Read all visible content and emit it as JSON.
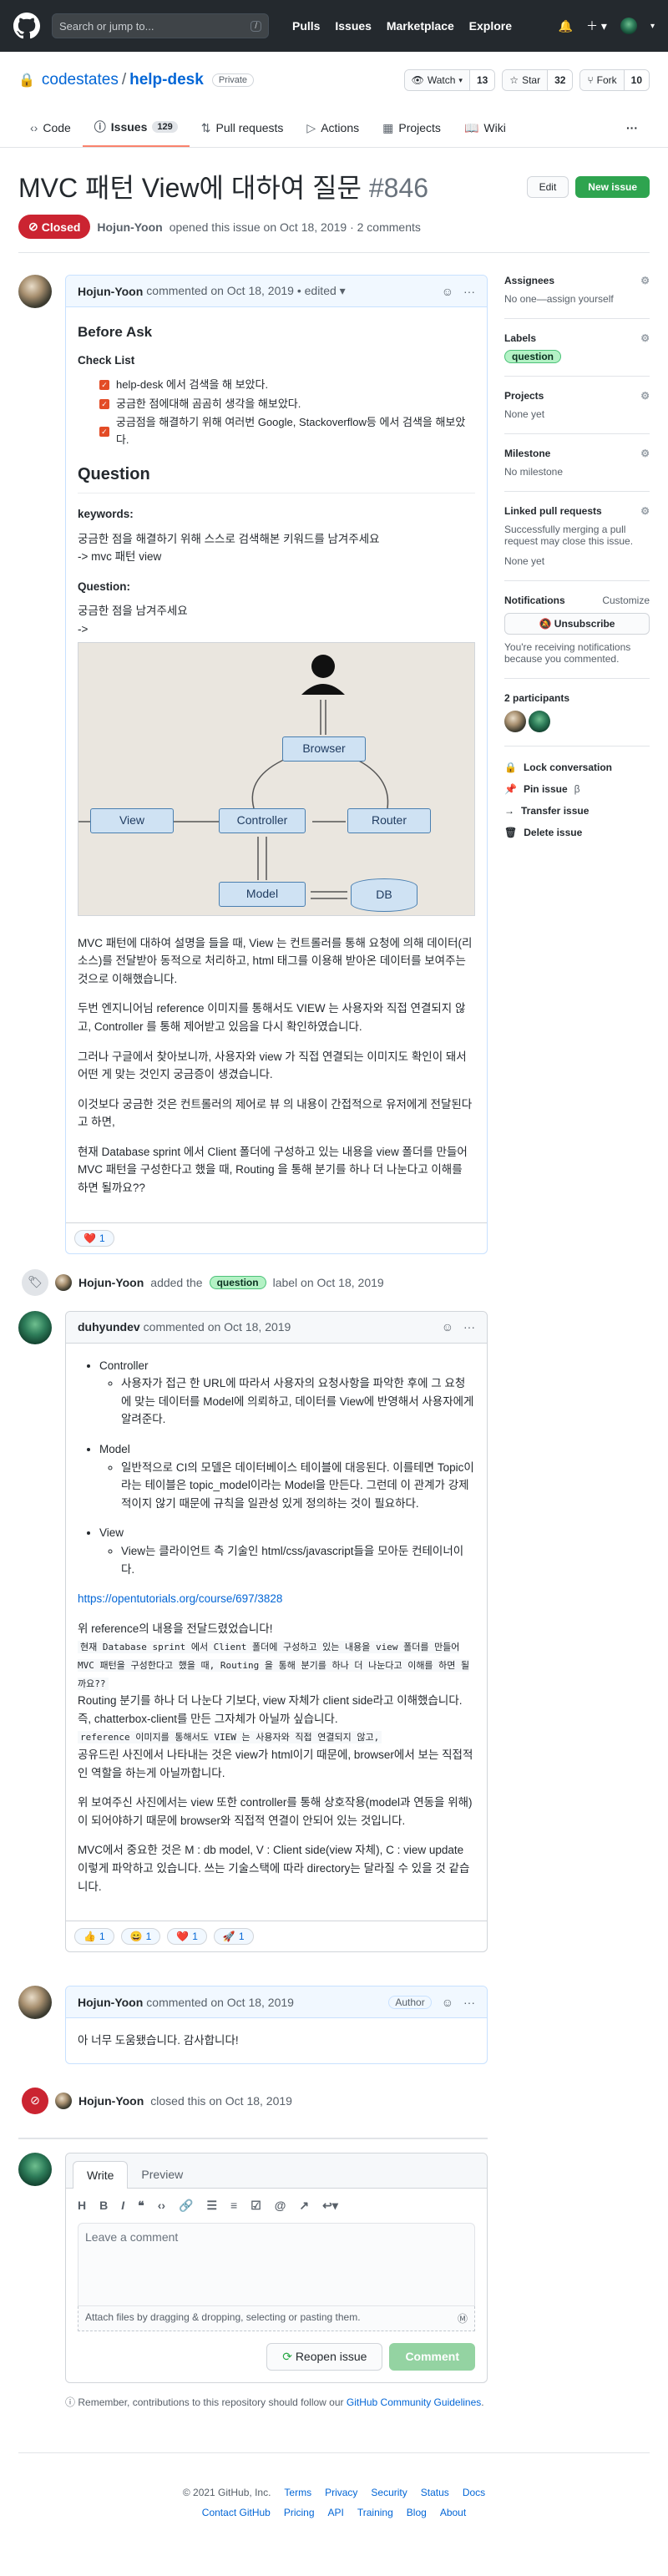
{
  "header": {
    "search_placeholder": "Search or jump to...",
    "search_key": "/",
    "nav": [
      "Pulls",
      "Issues",
      "Marketplace",
      "Explore"
    ]
  },
  "repo": {
    "owner": "codestates",
    "sep": "/",
    "name": "help-desk",
    "visibility": "Private",
    "watch_label": "Watch",
    "watch_count": "13",
    "star_label": "Star",
    "star_count": "32",
    "fork_label": "Fork",
    "fork_count": "10",
    "tabs": [
      {
        "label": "Code"
      },
      {
        "label": "Issues",
        "count": "129"
      },
      {
        "label": "Pull requests"
      },
      {
        "label": "Actions"
      },
      {
        "label": "Projects"
      },
      {
        "label": "Wiki"
      }
    ]
  },
  "issue": {
    "title": "MVC 패턴 View에 대하여 질문",
    "number": "#846",
    "edit_label": "Edit",
    "new_label": "New issue",
    "state": "Closed",
    "author": "Hojun-Yoon",
    "opened_text": "opened this issue on Oct 18, 2019 · 2 comments"
  },
  "comments": [
    {
      "author": "Hojun-Yoon",
      "meta": "commented on Oct 18, 2019 • edited ▾",
      "before_ask": "Before Ask",
      "checklist_title": "Check List",
      "checklist": [
        "help-desk 에서 검색을 해 보았다.",
        "궁금한 점에대해 곰곰히 생각을 해보았다.",
        "궁금점을 해결하기 위해 여러번 Google, Stackoverflow등 에서 검색을 해보았다."
      ],
      "question_title": "Question",
      "keywords_title": "keywords:",
      "keywords_text": "궁금한 점을 해결하기 위해 스스로 검색해본 키워드를 남겨주세요",
      "keywords_value": "-> mvc 패턴 view",
      "q_title": "Question:",
      "q_text": "궁금한 점을 남겨주세요",
      "q_arrow": "->",
      "diagram": {
        "view": "View",
        "controller": "Controller",
        "router": "Router",
        "browser": "Browser",
        "model": "Model",
        "db": "DB"
      },
      "paragraphs": [
        "MVC 패턴에 대하여 설명을 들을 때, View 는 컨트롤러를 통해 요청에 의해 데이터(리소스)를 전달받아 동적으로 처리하고, html 태그를 이용해 받아온 데이터를 보여주는 것으로 이해했습니다.",
        "두번 엔지니어님 reference 이미지를 통해서도 VIEW 는 사용자와 직접 연결되지 않고, Controller 를 통해 제어받고 있음을 다시 확인하였습니다.",
        "그러나 구글에서 찾아보니까, 사용자와 view 가 직접 연결되는 이미지도 확인이 돼서 어떤 게 맞는 것인지 궁금증이 생겼습니다.",
        "이것보다 궁금한 것은 컨트롤러의 제어로 뷰 의 내용이 간접적으로 유저에게 전달된다고 하면,",
        "현재 Database sprint 에서 Client 폴더에 구성하고 있는 내용을 view 폴더를 만들어 MVC 패턴을 구성한다고 했을 때, Routing 을 통해 분기를 하나 더 나눈다고 이해를 하면 될까요??"
      ],
      "reactions": [
        {
          "emoji": "❤️",
          "count": "1"
        }
      ]
    },
    {
      "author": "duhyundev",
      "meta": "commented on Oct 18, 2019",
      "items": [
        {
          "title": "Controller",
          "sub": "사용자가 접근 한 URL에 따라서 사용자의 요청사항을 파악한 후에 그 요청에 맞는 데이터를 Model에 의뢰하고, 데이터를 View에 반영해서 사용자에게 알려준다."
        },
        {
          "title": "Model",
          "sub": "일반적으로 CI의 모델은 데이터베이스 테이블에 대응된다. 이를테면 Topic이라는 테이블은 topic_model이라는 Model을 만든다. 그런데 이 관계가 강제적이지 않기 때문에 규칙을 일관성 있게 정의하는 것이 필요하다."
        },
        {
          "title": "View",
          "sub": "View는 클라이언트 측 기술인 html/css/javascript들을 모아둔 컨테이너이다."
        }
      ],
      "link": "https://opentutorials.org/course/697/3828",
      "quote_intro": "위 reference의 내용을 전달드렸었습니다!",
      "quote_code": "현재 Database sprint 에서 Client 폴더에 구성하고 있는 내용을 view 폴더를 만들어 MVC 패턴을 구성한다고 했을 때, Routing 을 통해 분기를 하나 더 나눈다고 이해를 하면 될까요??",
      "answer1": "Routing 분기를 하나 더 나눈다 기보다, view 자체가 client side라고 이해했습니다. 즉, chatterbox-client를 만든 그자체가 아닐까 싶습니다.",
      "quote_code2": "reference 이미지를 통해서도 VIEW 는 사용자와 직접 연결되지 않고,",
      "answer2": "공유드린 사진에서 나타내는 것은 view가 html이기 때문에, browser에서 보는 직접적인 역할을 하는게 아닐까합니다.",
      "answer3": "위 보여주신 사진에서는 view 또한 controller를 통해 상호작용(model과 연동을 위해)이 되어야하기 때문에 browser와 직접적 연결이 안되어 있는 것입니다.",
      "answer4": "MVC에서 중요한 것은 M : db model, V : Client side(view 자체), C : view update 이렇게 파악하고 있습니다. 쓰는 기술스택에 따라 directory는 달라질 수 있을 것 같습니다.",
      "reactions": [
        {
          "emoji": "👍",
          "count": "1"
        },
        {
          "emoji": "😄",
          "count": "1"
        },
        {
          "emoji": "❤️",
          "count": "1"
        },
        {
          "emoji": "🚀",
          "count": "1"
        }
      ]
    },
    {
      "author": "Hojun-Yoon",
      "meta": "commented on Oct 18, 2019",
      "badge": "Author",
      "body": "아 너무 도움됐습니다. 감사합니다!"
    }
  ],
  "events": {
    "labeled": {
      "actor": "Hojun-Yoon",
      "pre": "added the",
      "label": "question",
      "post": "label on Oct 18, 2019"
    },
    "closed": {
      "actor": "Hojun-Yoon",
      "text": "closed this on Oct 18, 2019"
    }
  },
  "composer": {
    "write": "Write",
    "preview": "Preview",
    "placeholder": "Leave a comment",
    "attach": "Attach files by dragging & dropping, selecting or pasting them.",
    "reopen": "Reopen issue",
    "comment": "Comment",
    "notice_pre": "Remember, contributions to this repository should follow our",
    "notice_link": "GitHub Community Guidelines",
    "notice_post": "."
  },
  "sidebar": {
    "assignees_title": "Assignees",
    "assignees_value": "No one—assign yourself",
    "labels_title": "Labels",
    "labels_value": "question",
    "projects_title": "Projects",
    "projects_value": "None yet",
    "milestone_title": "Milestone",
    "milestone_value": "No milestone",
    "linked_title": "Linked pull requests",
    "linked_desc": "Successfully merging a pull request may close this issue.",
    "linked_value": "None yet",
    "notif_title": "Notifications",
    "notif_customize": "Customize",
    "unsubscribe": "Unsubscribe",
    "notif_desc": "You're receiving notifications because you commented.",
    "participants": "2 participants",
    "actions": [
      "Lock conversation",
      "Pin issue",
      "Transfer issue",
      "Delete issue"
    ],
    "pin_beta": "β"
  },
  "footer": {
    "copyright": "© 2021 GitHub, Inc.",
    "row1": [
      "Terms",
      "Privacy",
      "Security",
      "Status",
      "Docs"
    ],
    "row2": [
      "Contact GitHub",
      "Pricing",
      "API",
      "Training",
      "Blog",
      "About"
    ]
  },
  "colors": {
    "closed": "#cb2431",
    "accent": "#0366d6",
    "green": "#2ea44f"
  }
}
